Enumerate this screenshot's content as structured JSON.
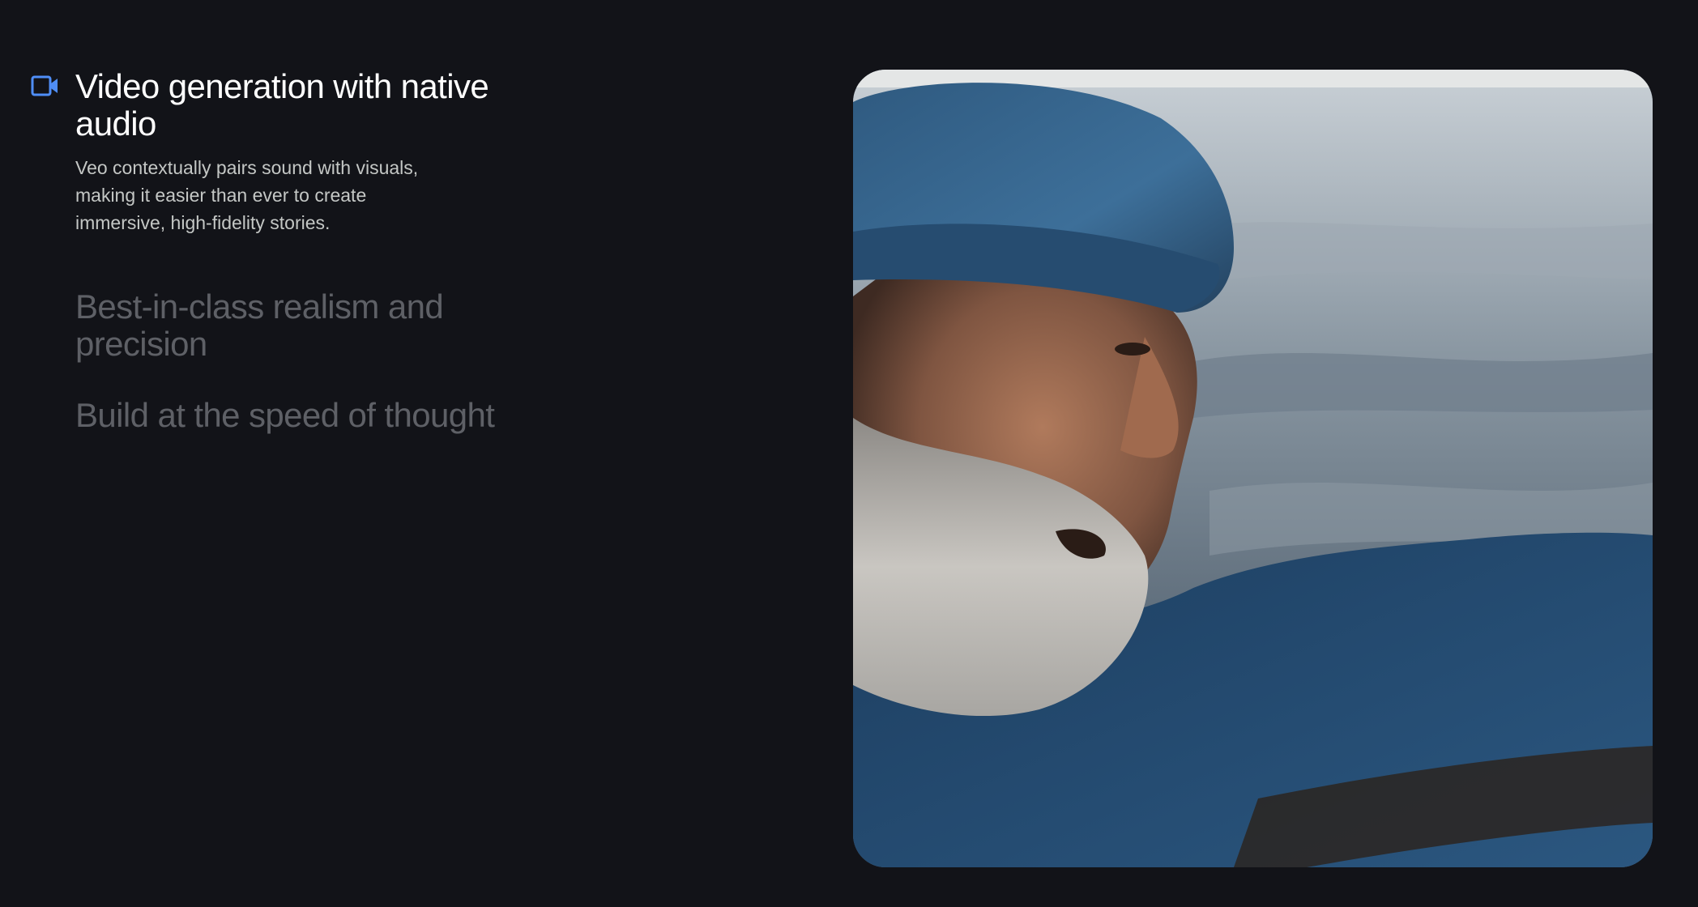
{
  "features": [
    {
      "title": "Video generation with native audio",
      "description": "Veo contextually pairs sound with visuals, making it easier than ever to create immersive, high-fidelity stories.",
      "icon": "video-camera-icon",
      "active": true
    },
    {
      "title": "Best-in-class realism and precision",
      "active": false
    },
    {
      "title": "Build at the speed of thought",
      "active": false
    }
  ],
  "media": {
    "subject": "elderly-fisherman-at-sea-video-frame"
  },
  "colors": {
    "background": "#121318",
    "active_title": "#ffffff",
    "inactive_title": "#5e6066",
    "description": "#c4c7c5",
    "icon_accent": "#4f8ef7"
  }
}
